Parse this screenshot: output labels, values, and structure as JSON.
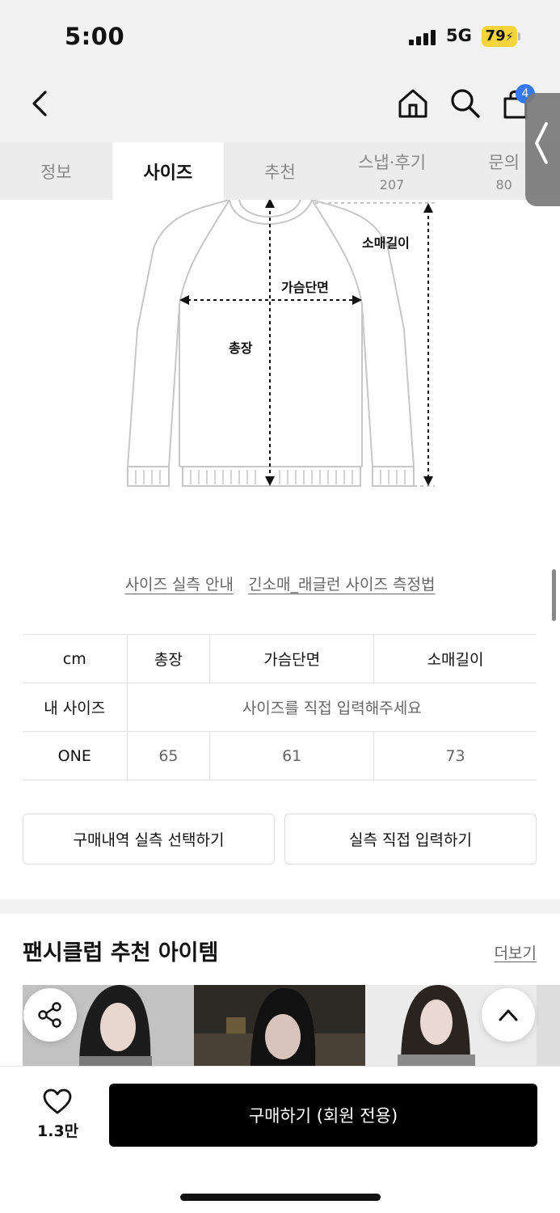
{
  "status": {
    "time": "5:00",
    "network": "5G",
    "battery": "79"
  },
  "nav": {
    "cart_count": "4"
  },
  "tabs": [
    {
      "label": "정보",
      "count": ""
    },
    {
      "label": "사이즈",
      "count": ""
    },
    {
      "label": "추천",
      "count": ""
    },
    {
      "label": "스냅·후기",
      "count": "207"
    },
    {
      "label": "문의",
      "count": "80"
    }
  ],
  "diagram": {
    "sleeve_label": "소매길이",
    "chest_label": "가슴단면",
    "length_label": "총장"
  },
  "links": {
    "guide": "사이즈 실측 안내",
    "method": "긴소매_래글런 사이즈 측정법"
  },
  "table": {
    "unit": "cm",
    "columns": [
      "총장",
      "가슴단면",
      "소매길이"
    ],
    "my_size_label": "내 사이즈",
    "my_size_placeholder": "사이즈를 직접 입력해주세요",
    "rows": [
      {
        "size": "ONE",
        "values": [
          "65",
          "61",
          "73"
        ]
      }
    ]
  },
  "buttons": {
    "select_history": "구매내역 실측 선택하기",
    "direct_input": "실측 직접 입력하기"
  },
  "recommend": {
    "title": "팬시클럽 추천 아이템",
    "more": "더보기"
  },
  "bottom": {
    "likes": "1.3만",
    "buy": "구매하기 (회원 전용)"
  },
  "colors": {
    "accent_blue": "#3478f6",
    "battery_yellow": "#f5d53b",
    "buy_button": "#000000"
  }
}
